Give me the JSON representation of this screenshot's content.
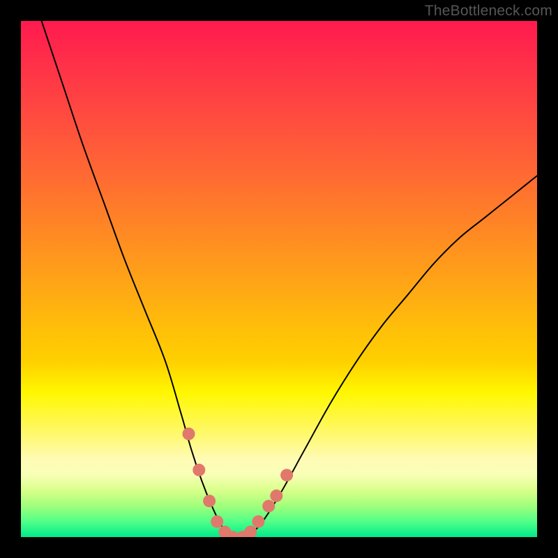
{
  "watermark": "TheBottleneck.com",
  "chart_data": {
    "type": "line",
    "title": "",
    "xlabel": "",
    "ylabel": "",
    "xlim": [
      0,
      100
    ],
    "ylim": [
      0,
      100
    ],
    "background_gradient_stops": [
      {
        "pos": 0,
        "color": "#ff1a4f"
      },
      {
        "pos": 50,
        "color": "#ff9d1a"
      },
      {
        "pos": 72,
        "color": "#fff700"
      },
      {
        "pos": 100,
        "color": "#00ea8a"
      }
    ],
    "series": [
      {
        "name": "bottleneck-curve",
        "color": "#000000",
        "x": [
          4,
          8,
          12,
          16,
          20,
          24,
          28,
          31,
          33,
          35,
          37,
          39,
          41,
          43,
          46,
          50,
          55,
          60,
          65,
          70,
          75,
          80,
          85,
          90,
          95,
          100
        ],
        "y": [
          100,
          88,
          76,
          65,
          54,
          44,
          34,
          24,
          17,
          11,
          6,
          2,
          0,
          0,
          2,
          8,
          17,
          26,
          34,
          41,
          47,
          53,
          58,
          62,
          66,
          70
        ]
      }
    ],
    "markers": {
      "name": "highlight-dots",
      "color": "#e0796b",
      "radius_px": 9,
      "points": [
        {
          "x": 32.5,
          "y": 20
        },
        {
          "x": 34.5,
          "y": 13
        },
        {
          "x": 36.5,
          "y": 7
        },
        {
          "x": 38,
          "y": 3
        },
        {
          "x": 39.5,
          "y": 1
        },
        {
          "x": 41,
          "y": 0
        },
        {
          "x": 43,
          "y": 0
        },
        {
          "x": 44.5,
          "y": 1
        },
        {
          "x": 46,
          "y": 3
        },
        {
          "x": 48,
          "y": 6
        },
        {
          "x": 49.5,
          "y": 8
        },
        {
          "x": 51.5,
          "y": 12
        }
      ]
    }
  }
}
